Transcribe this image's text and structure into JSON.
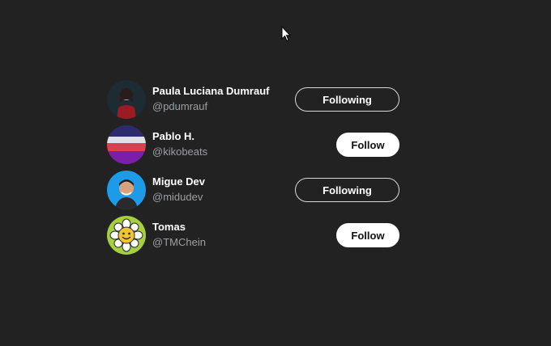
{
  "colors": {
    "background": "#222222",
    "follow_button_bg": "#ffffff",
    "handle_text": "#9aa0a6"
  },
  "users": [
    {
      "name": "Paula Luciana Dumrauf",
      "handle": "@pdumrauf",
      "button_label": "Following",
      "is_following": true
    },
    {
      "name": "Pablo H.",
      "handle": "@kikobeats",
      "button_label": "Follow",
      "is_following": false
    },
    {
      "name": "Migue Dev",
      "handle": "@midudev",
      "button_label": "Following",
      "is_following": true
    },
    {
      "name": "Tomas",
      "handle": "@TMChein",
      "button_label": "Follow",
      "is_following": false
    }
  ]
}
